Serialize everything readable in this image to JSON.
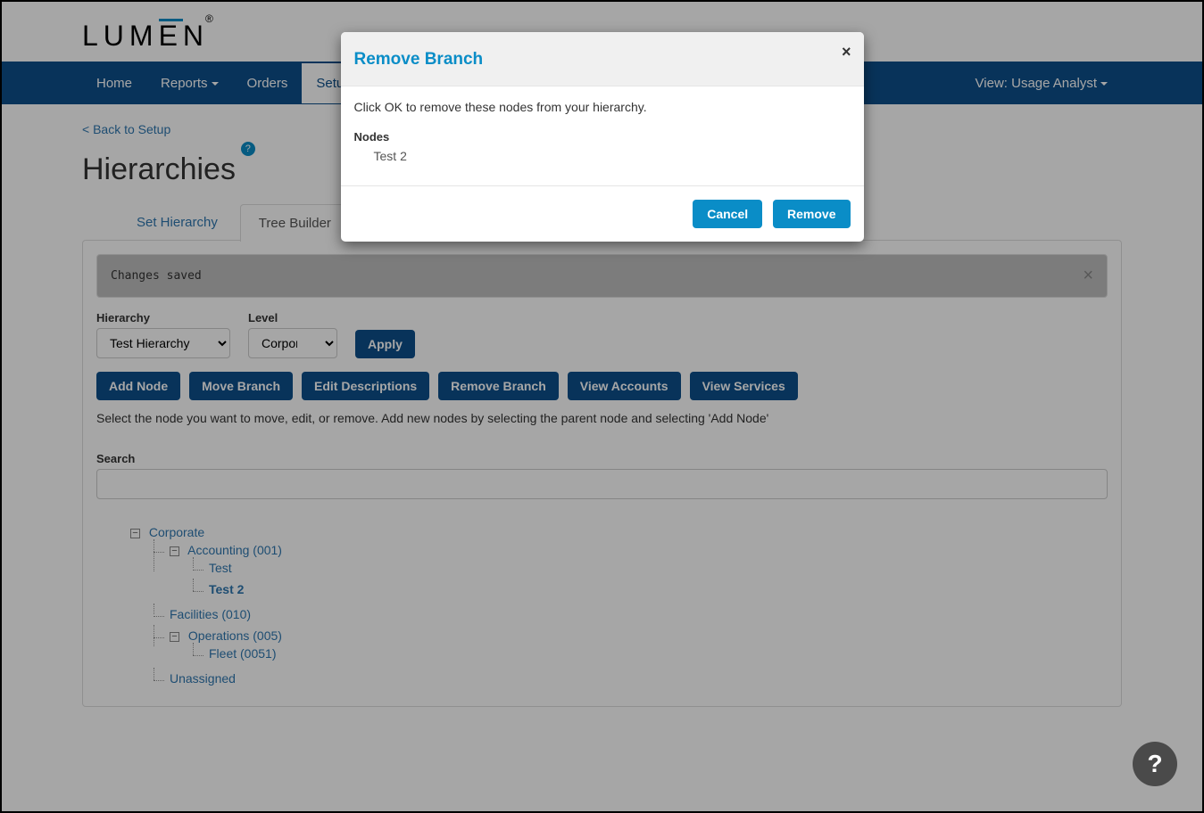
{
  "logo": {
    "text_prefix": "LUM",
    "text_e": "E",
    "text_suffix": "N",
    "registered": "®"
  },
  "nav": {
    "items": [
      {
        "label": "Home"
      },
      {
        "label": "Reports",
        "caret": true
      },
      {
        "label": "Orders"
      },
      {
        "label": "Setup",
        "active": true
      }
    ],
    "view_label": "View: Usage Analyst"
  },
  "back_link": "< Back to Setup",
  "page_title": "Hierarchies",
  "help_badge": "?",
  "tabs": [
    {
      "label": "Set Hierarchy"
    },
    {
      "label": "Tree Builder",
      "active": true
    }
  ],
  "alert": {
    "message": "Changes saved",
    "close": "×"
  },
  "form": {
    "hierarchy_label": "Hierarchy",
    "hierarchy_value": "Test Hierarchy",
    "level_label": "Level",
    "level_value": "Corporate",
    "apply": "Apply"
  },
  "buttons": {
    "add_node": "Add Node",
    "move_branch": "Move Branch",
    "edit_desc": "Edit Descriptions",
    "remove_branch": "Remove Branch",
    "view_accounts": "View Accounts",
    "view_services": "View Services"
  },
  "hint": "Select the node you want to move, edit, or remove. Add new nodes by selecting the parent node and selecting 'Add Node'",
  "search": {
    "label": "Search",
    "value": ""
  },
  "tree": {
    "root": "Corporate",
    "accounting": "Accounting (001)",
    "test": "Test",
    "test2": "Test 2",
    "facilities": "Facilities (010)",
    "operations": "Operations (005)",
    "fleet": "Fleet (0051)",
    "unassigned": "Unassigned"
  },
  "modal": {
    "title": "Remove Branch",
    "close": "×",
    "desc": "Click OK to remove these nodes from your hierarchy.",
    "nodes_label": "Nodes",
    "node_item": "Test 2",
    "cancel": "Cancel",
    "remove": "Remove"
  },
  "fab": "?"
}
